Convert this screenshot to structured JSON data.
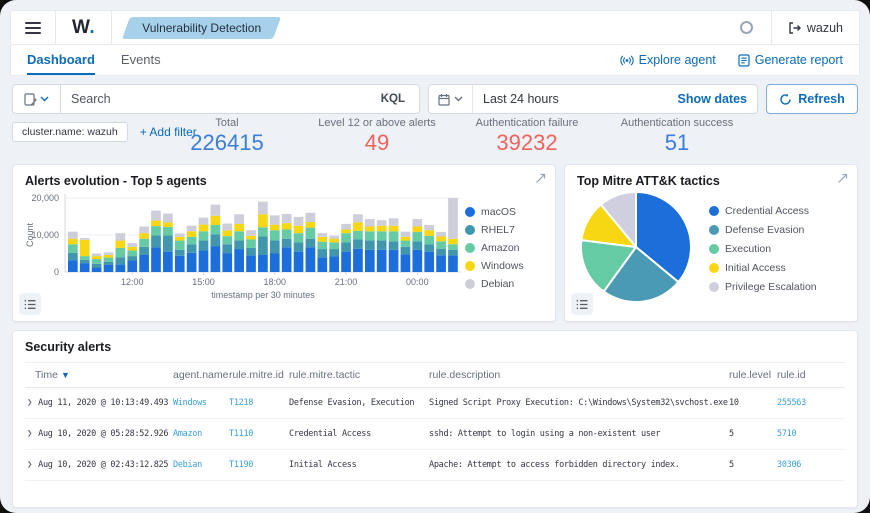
{
  "window": {
    "brand": "W",
    "brand_dot": ".",
    "breadcrumb": "Vulnerability Detection",
    "user": "wazuh"
  },
  "tabs": [
    {
      "label": "Dashboard",
      "active": true
    },
    {
      "label": "Events",
      "active": false
    }
  ],
  "tab_actions": {
    "explore_agent": "Explore agent",
    "generate_report": "Generate report"
  },
  "query": {
    "search_placeholder": "Search",
    "kql_label": "KQL",
    "time_range": "Last 24 hours",
    "show_dates_label": "Show dates",
    "refresh_label": "Refresh",
    "filter_pill": "cluster.name: wazuh",
    "add_filter_label": "+ Add filter"
  },
  "stats": [
    {
      "label": "Total",
      "value": "226415",
      "color": "#3b7dd8"
    },
    {
      "label": "Level 12 or above alerts",
      "value": "49",
      "color": "#f0635b"
    },
    {
      "label": "Authentication failure",
      "value": "39232",
      "color": "#f0635b"
    },
    {
      "label": "Authentication success",
      "value": "51",
      "color": "#3b7dd8"
    }
  ],
  "panels": {
    "alerts_evolution_title": "Alerts evolution - Top 5 agents",
    "mitre_title": "Top Mitre ATT&K tactics",
    "security_title": "Security alerts"
  },
  "chart_data": [
    {
      "type": "bar",
      "stacked": true,
      "title": "Alerts evolution - Top 5 agents",
      "xlabel": "timestamp per 30 minutes",
      "ylabel": "Count",
      "ylim": [
        0,
        20000
      ],
      "yticks": [
        0,
        10000,
        20000
      ],
      "ytick_labels": [
        "0",
        "10,000",
        "20,000"
      ],
      "xtick_indices": [
        5,
        11,
        17,
        23,
        29
      ],
      "xtick_labels": [
        "12:00",
        "15:00",
        "18:00",
        "21:00",
        "00:00"
      ],
      "grid": true,
      "legend_position": "right",
      "series": [
        {
          "name": "macOS",
          "color": "#1c6fdb",
          "values": [
            3200,
            2400,
            1200,
            1900,
            2000,
            3100,
            4600,
            6700,
            5500,
            4400,
            5200,
            5800,
            7000,
            5000,
            6200,
            4500,
            4600,
            5000,
            6700,
            5500,
            6700,
            4000,
            4200,
            5500,
            6300,
            6000,
            6000,
            6000,
            4800,
            6000,
            5500,
            4500,
            4500
          ]
        },
        {
          "name": "RHEL7",
          "color": "#3f96ad",
          "values": [
            2000,
            900,
            1000,
            800,
            2000,
            1200,
            2200,
            3200,
            4400,
            1600,
            2300,
            2700,
            3200,
            2500,
            2300,
            2000,
            5000,
            3500,
            2300,
            2500,
            2300,
            2200,
            2000,
            2500,
            2500,
            2500,
            2500,
            2300,
            2000,
            2300,
            2000,
            1800,
            1500
          ]
        },
        {
          "name": "Amazon",
          "color": "#65cba5",
          "values": [
            2300,
            1000,
            1300,
            1200,
            2500,
            1500,
            2200,
            2500,
            2300,
            2500,
            2000,
            2500,
            2500,
            2200,
            2500,
            2300,
            2500,
            2800,
            2500,
            2500,
            3000,
            2000,
            1800,
            2500,
            2300,
            2500,
            2500,
            2700,
            1700,
            2500,
            2300,
            2000,
            1500
          ]
        },
        {
          "name": "Windows",
          "color": "#f7d713",
          "values": [
            1500,
            4400,
            800,
            700,
            2000,
            1000,
            1500,
            1500,
            1200,
            1000,
            1500,
            1800,
            2500,
            1500,
            2000,
            1000,
            3500,
            1500,
            1700,
            2000,
            1500,
            1300,
            1000,
            1000,
            2300,
            1300,
            1500,
            1500,
            1000,
            1500,
            1500,
            1300,
            1500
          ]
        },
        {
          "name": "Debian",
          "color": "#cdced9",
          "values": [
            1900,
            500,
            700,
            700,
            2000,
            1000,
            1800,
            2700,
            2400,
            900,
            1500,
            1900,
            3000,
            1900,
            2600,
            1500,
            3400,
            2500,
            2500,
            2400,
            2500,
            1000,
            800,
            1500,
            2200,
            2000,
            1500,
            2000,
            1400,
            2000,
            1400,
            1200,
            11000
          ]
        }
      ]
    },
    {
      "type": "pie",
      "title": "Top Mitre ATT&K tactics",
      "legend_position": "right",
      "labels": [
        "Credential Access",
        "Defense Evasion",
        "Execution",
        "Initial Access",
        "Privilege Escalation"
      ],
      "values": [
        36,
        24,
        17,
        12,
        11
      ],
      "colors": [
        "#1c6fdb",
        "#4a9ab5",
        "#65cba5",
        "#f7d713",
        "#cfcfe0"
      ]
    }
  ],
  "table": {
    "columns": [
      "Time",
      "agent.name",
      "rule.mitre.id",
      "rule.mitre.tactic",
      "rule.description",
      "rule.level",
      "rule.id"
    ],
    "rows": [
      {
        "time": "Aug 11, 2020 @ 10:13:49.493",
        "agent": "Windows",
        "mitre_id": "T1218",
        "tactic": "Defense Evasion, Execution",
        "description": "Signed Script Proxy Execution: C:\\Windows\\System32\\svchost.exe",
        "level": "10",
        "rule_id": "255563"
      },
      {
        "time": "Aug 10, 2020 @ 05:28:52.926",
        "agent": "Amazon",
        "mitre_id": "T1110",
        "tactic": "Credential Access",
        "description": "sshd: Attempt to login using a non-existent user",
        "level": "5",
        "rule_id": "5710"
      },
      {
        "time": "Aug 10, 2020 @ 02:43:12.825",
        "agent": "Debian",
        "mitre_id": "T1190",
        "tactic": "Initial Access",
        "description": "Apache: Attempt to access forbidden directory index.",
        "level": "5",
        "rule_id": "30306"
      }
    ]
  }
}
